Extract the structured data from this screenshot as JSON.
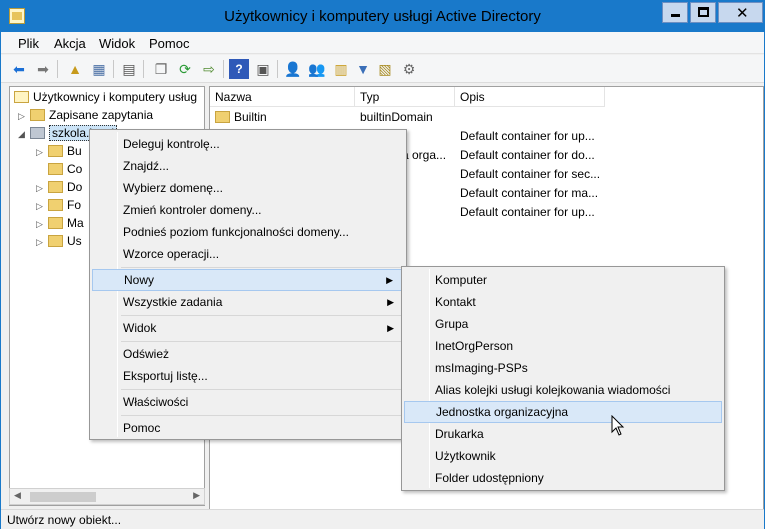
{
  "window": {
    "title": "Użytkownicy i komputery usługi Active Directory",
    "buttons": {
      "minimize": "minimize",
      "maximize": "maximize",
      "close": "✕"
    }
  },
  "menubar": [
    "Plik",
    "Akcja",
    "Widok",
    "Pomoc"
  ],
  "toolbar_icons": [
    "back-icon",
    "forward-icon",
    "up-icon",
    "console-tree-icon",
    "properties-icon",
    "export-icon",
    "refresh-icon",
    "export-list-icon",
    "help-icon",
    "action-pane-icon",
    "add-user-icon",
    "add-group-icon",
    "add-ou-icon",
    "filter-icon",
    "find-icon",
    "delegate-icon"
  ],
  "tree": {
    "root": "Użytkownicy i komputery usług",
    "saved_queries": "Zapisane zapytania",
    "domain": "szkola.local",
    "children": [
      "Bu",
      "Co",
      "Do",
      "Fo",
      "Ma",
      "Us"
    ]
  },
  "list": {
    "headers": [
      "Nazwa",
      "Typ",
      "Opis"
    ],
    "rows": [
      [
        "Builtin",
        "builtinDomain",
        ""
      ],
      [
        "",
        "r",
        "Default container for up..."
      ],
      [
        "",
        "a orga...",
        "Default container for do..."
      ],
      [
        "",
        "r",
        "Default container for sec..."
      ],
      [
        "",
        "r",
        "Default container for ma..."
      ],
      [
        "",
        "r",
        "Default container for up..."
      ]
    ]
  },
  "context_menu": {
    "items": [
      "Deleguj kontrolę...",
      "Znajdź...",
      "Wybierz domenę...",
      "Zmień kontroler domeny...",
      "Podnieś poziom funkcjonalności domeny...",
      "Wzorce operacji...",
      "Nowy",
      "Wszystkie zadania",
      "Widok",
      "Odśwież",
      "Eksportuj listę...",
      "Właściwości",
      "Pomoc"
    ],
    "highlighted": "Nowy"
  },
  "submenu": {
    "items": [
      "Komputer",
      "Kontakt",
      "Grupa",
      "InetOrgPerson",
      "msImaging-PSPs",
      "Alias kolejki usługi kolejkowania wiadomości",
      "Jednostka organizacyjna",
      "Drukarka",
      "Użytkownik",
      "Folder udostępniony"
    ],
    "highlighted": "Jednostka organizacyjna"
  },
  "status": {
    "text": "Utwórz nowy obiekt..."
  }
}
